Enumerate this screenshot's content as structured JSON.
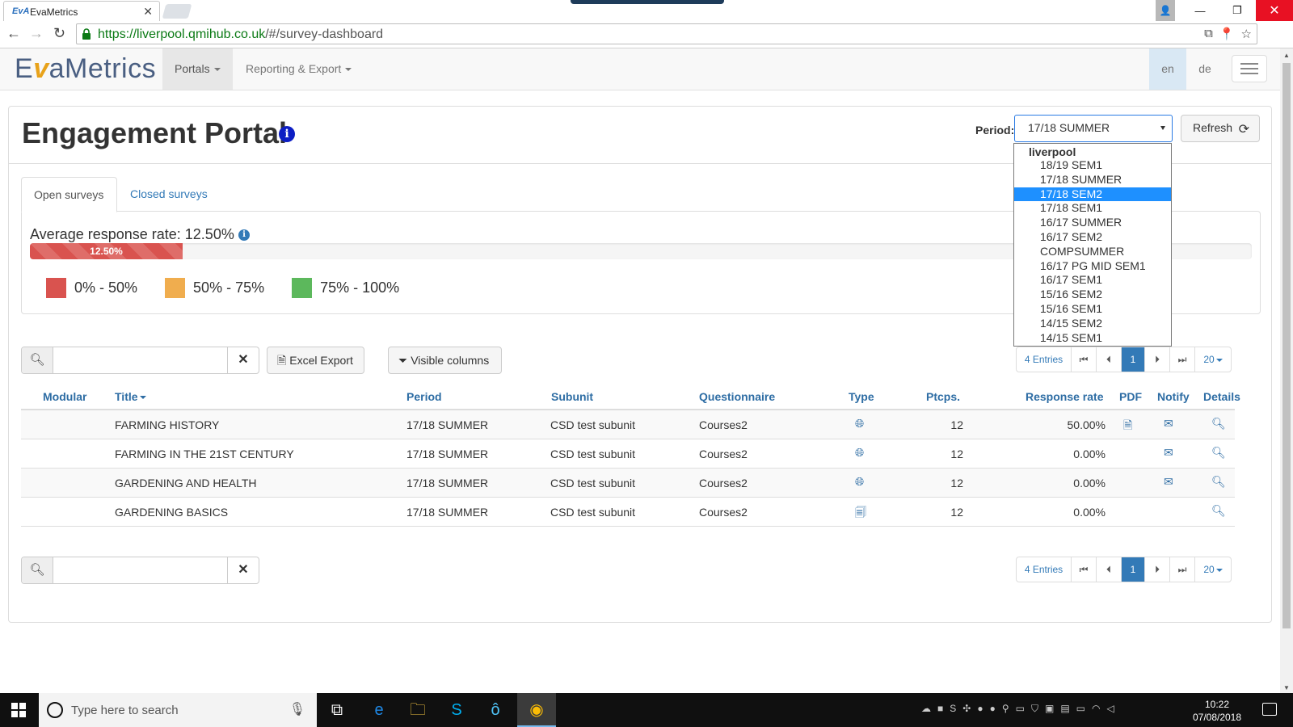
{
  "browser": {
    "tab_title": "EvaMetrics",
    "url_domain": "https://liverpool.qmihub.co.uk",
    "url_path": "/#/survey-dashboard"
  },
  "navbar": {
    "logo": {
      "prefix": "E",
      "v": "v",
      "rest": "aMetrics"
    },
    "portals_label": "Portals",
    "reporting_label": "Reporting & Export",
    "lang_en": "en",
    "lang_de": "de"
  },
  "header": {
    "title": "Engagement Portal",
    "period_label": "Period:",
    "period_value": "17/18 SUMMER",
    "refresh_label": "Refresh"
  },
  "tabs": {
    "open": "Open surveys",
    "closed": "Closed surveys"
  },
  "rate": {
    "title": "Average response rate: 12.50%",
    "progress_label": "12.50%",
    "progress_fraction": 0.125,
    "legend": [
      {
        "label": "0% - 50%",
        "color": "#d9534f"
      },
      {
        "label": "50% - 75%",
        "color": "#f0ad4e"
      },
      {
        "label": "75% - 100%",
        "color": "#5cb85c"
      }
    ]
  },
  "toolbar": {
    "search_placeholder": "",
    "excel_label": "Excel Export",
    "columns_label": "Visible columns"
  },
  "pager": {
    "entries": "4 Entries",
    "current_page": "1",
    "page_size": "20"
  },
  "table": {
    "headers": {
      "modular": "Modular",
      "title": "Title",
      "period": "Period",
      "subunit": "Subunit",
      "questionnaire": "Questionnaire",
      "type": "Type",
      "ptcps": "Ptcps.",
      "response_rate": "Response rate",
      "pdf": "PDF",
      "notify": "Notify",
      "details": "Details"
    },
    "rows": [
      {
        "title": "FARMING HISTORY",
        "period": "17/18 SUMMER",
        "subunit": "CSD test subunit",
        "questionnaire": "Courses2",
        "type_icon": "globe-icon",
        "ptcps": "12",
        "response_rate": "50.00%",
        "pdf": true,
        "notify": true
      },
      {
        "title": "FARMING IN THE 21ST CENTURY",
        "period": "17/18 SUMMER",
        "subunit": "CSD test subunit",
        "questionnaire": "Courses2",
        "type_icon": "globe-icon",
        "ptcps": "12",
        "response_rate": "0.00%",
        "pdf": false,
        "notify": true
      },
      {
        "title": "GARDENING AND HEALTH",
        "period": "17/18 SUMMER",
        "subunit": "CSD test subunit",
        "questionnaire": "Courses2",
        "type_icon": "globe-icon",
        "ptcps": "12",
        "response_rate": "0.00%",
        "pdf": false,
        "notify": true
      },
      {
        "title": "GARDENING BASICS",
        "period": "17/18 SUMMER",
        "subunit": "CSD test subunit",
        "questionnaire": "Courses2",
        "type_icon": "paper-icon",
        "ptcps": "12",
        "response_rate": "0.00%",
        "pdf": false,
        "notify": false
      }
    ]
  },
  "dropdown": {
    "group": "liverpool",
    "options": [
      "18/19 SEM1",
      "17/18 SUMMER",
      "17/18 SEM2",
      "17/18 SEM1",
      "16/17 SUMMER",
      "16/17 SEM2",
      "COMPSUMMER",
      "16/17 PG MID SEM1",
      "16/17 SEM1",
      "15/16 SEM2",
      "15/16 SEM1",
      "14/15 SEM2",
      "14/15 SEM1"
    ],
    "highlighted": "17/18 SEM2"
  },
  "taskbar": {
    "search_text": "Type here to search",
    "time": "10:22",
    "date": "07/08/2018"
  }
}
